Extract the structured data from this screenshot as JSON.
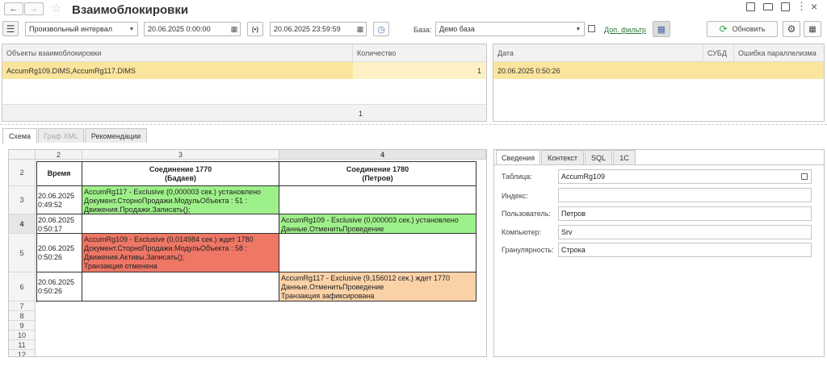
{
  "title": "Взаимоблокировки",
  "toolbar": {
    "period_mode": "Произвольный интервал",
    "date_from": "20.06.2025  0:00:00",
    "date_to": "20.06.2025 23:59:59",
    "base_label": "База:",
    "base_value": "Демо база",
    "extra_filter": "Доп. фильтр",
    "refresh_label": "Обновить"
  },
  "objects_table": {
    "columns": [
      "Объекты взаимоблокировки",
      "Количество"
    ],
    "rows": [
      {
        "object": "AccumRg109.DIMS,AccumRg117.DIMS",
        "count": "1"
      }
    ],
    "total": "1"
  },
  "dates_table": {
    "columns": [
      "Дата",
      "СУБД",
      "Ошибка параллелизма"
    ],
    "rows": [
      {
        "date": "20.06.2025 0:50:26"
      }
    ]
  },
  "tabs": [
    "Схема",
    "Граф XML",
    "Рекомендации"
  ],
  "scheme": {
    "col_headers": [
      "2",
      "3",
      "4"
    ],
    "row_headers": [
      "2",
      "3",
      "4",
      "5",
      "6",
      "7",
      "8",
      "9",
      "10",
      "11",
      "12"
    ],
    "header": {
      "time": "Время",
      "conn1_line1": "Соединение 1770",
      "conn1_line2": "(Бадаев)",
      "conn2_line1": "Соединение 1780",
      "conn2_line2": "(Петров)"
    },
    "rows": [
      {
        "time1": "20.06.2025",
        "time2": "0:49:52",
        "c1": [
          "AccumRg117 - Exclusive (0,000003 сек.) установлено",
          "Документ.СторноПродажи.МодульОбъекта : 51 :",
          "Движения.Продажи.Записать();"
        ],
        "c2": []
      },
      {
        "time1": "20.06.2025",
        "time2": "0:50:17",
        "c1": [],
        "c2": [
          "AccumRg109 - Exclusive (0,000003 сек.) установлено",
          "Данные.ОтменитьПроведение"
        ]
      },
      {
        "time1": "20.06.2025",
        "time2": "0:50:26",
        "c1": [
          "AccumRg109 - Exclusive (0,014984 сек.) ждет 1780",
          "Документ.СторноПродажи.МодульОбъекта : 58 :",
          "Движения.Активы.Записать();",
          "Транзакция отменена"
        ],
        "c2": []
      },
      {
        "time1": "20.06.2025",
        "time2": "0:50:26",
        "c1": [],
        "c2": [
          "AccumRg117 - Exclusive (9,156012 сек.) ждет 1770",
          "Данные.ОтменитьПроведение",
          "Транзакция зафиксирована"
        ]
      }
    ]
  },
  "details_tabs": [
    "Сведения",
    "Контекст",
    "SQL",
    "1С"
  ],
  "details": {
    "table_label": "Таблица:",
    "table_value": "AccumRg109",
    "index_label": "Индекс:",
    "index_value": "",
    "user_label": "Пользователь:",
    "user_value": "Петров",
    "computer_label": "Компьютер:",
    "computer_value": "Srv",
    "granularity_label": "Гранулярность:",
    "granularity_value": "Строка"
  },
  "colors": {
    "selected_row": "#fbe59c",
    "green_cell": "#9ef08a",
    "red_cell": "#ee7766",
    "orange_cell": "#fbd2a8",
    "link": "#2a7a3a",
    "refresh_icon": "#2aa84a"
  }
}
